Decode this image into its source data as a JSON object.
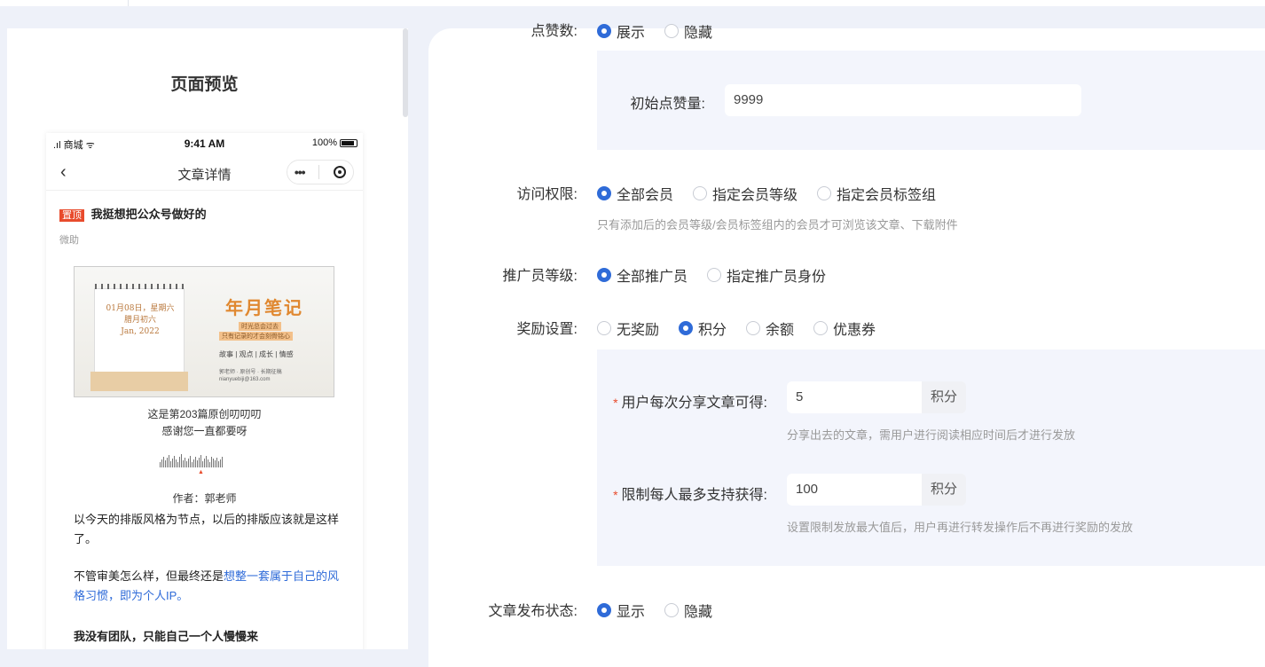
{
  "preview": {
    "title": "页面预览",
    "status": {
      "carrier": "商城",
      "time": "9:41 AM",
      "battery": "100%"
    },
    "nav_title": "文章详情",
    "article": {
      "badge": "置顶",
      "headline": "我挺想把公众号做好的",
      "source": "微助",
      "cover": {
        "date_line1": "01月08日，星期六",
        "date_line2": "腊月初六",
        "date_line3": "Jan, 2022",
        "title": "年月笔记",
        "line1": "时光总会过去",
        "line2": "只有记录的才会刻骨铭心",
        "line3": "故事 | 观点 | 成长 | 情感",
        "line4": "郭老师 · 原创号 · 长期征稿",
        "line5": "nianyuebiji@163.com"
      },
      "caption1": "这是第203篇原创叨叨叨",
      "caption2": "感谢您一直都要呀",
      "author": "作者：郭老师",
      "para1": "以今天的排版风格为节点，以后的排版应该就是这样了。",
      "para2_prefix": "不管审美怎么样，但最终还是",
      "para2_link": "想整一套属于自己的风格习惯，即为个人IP。",
      "para3": "我没有团队，只能自己一个人慢慢来"
    }
  },
  "form": {
    "likes": {
      "label": "点赞数:",
      "options": [
        "展示",
        "隐藏"
      ],
      "selected": 0
    },
    "initial_likes": {
      "label": "初始点赞量:",
      "value": "9999"
    },
    "access": {
      "label": "访问权限:",
      "options": [
        "全部会员",
        "指定会员等级",
        "指定会员标签组"
      ],
      "selected": 0,
      "hint": "只有添加后的会员等级/会员标签组内的会员才可浏览该文章、下载附件"
    },
    "promoter": {
      "label": "推广员等级:",
      "options": [
        "全部推广员",
        "指定推广员身份"
      ],
      "selected": 0
    },
    "reward": {
      "label": "奖励设置:",
      "options": [
        "无奖励",
        "积分",
        "余额",
        "优惠券"
      ],
      "selected": 1
    },
    "share_points": {
      "label": "用户每次分享文章可得:",
      "value": "5",
      "unit": "积分",
      "hint": "分享出去的文章，需用户进行阅读相应时间后才进行发放"
    },
    "limit_points": {
      "label": "限制每人最多支持获得:",
      "value": "100",
      "unit": "积分",
      "hint": "设置限制发放最大值后，用户再进行转发操作后不再进行奖励的发放"
    },
    "publish": {
      "label": "文章发布状态:",
      "options": [
        "显示",
        "隐藏"
      ],
      "selected": 0
    }
  },
  "colors": {
    "primary": "#2f6bd8",
    "required": "#e84b2c",
    "badge": "#e84b2c",
    "panel": "#f3f5fc"
  }
}
